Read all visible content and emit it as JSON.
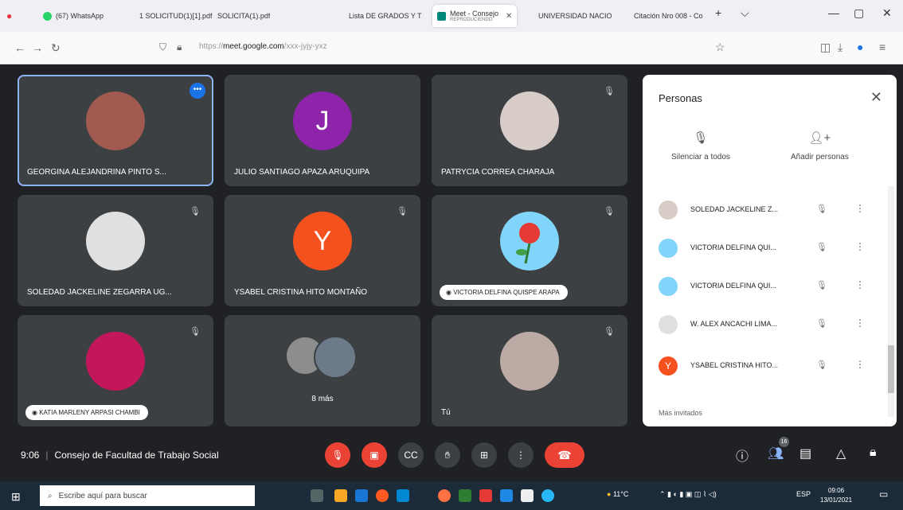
{
  "browser": {
    "tabs": [
      {
        "label": "(67) WhatsApp",
        "color": "#25d366"
      },
      {
        "label": "1 SOLICITUD(1)[1].pdf",
        "color": "#d93025"
      },
      {
        "label": "SOLICITA(1).pdf",
        "color": "#d93025"
      },
      {
        "label": "Lista DE GRADOS Y T",
        "color": "#2b579a"
      },
      {
        "label": "Meet - Consejo",
        "sublabel": "REPRODUCIENDO",
        "color": "#00897b",
        "active": true
      },
      {
        "label": "UNIVERSIDAD NACIO",
        "color": "#1a73e8"
      },
      {
        "label": "Citación Nro 008 - Co",
        "color": "#1a73e8"
      }
    ],
    "url_prefix": "https://",
    "url_domain": "meet.google.com",
    "url_path": "/xxx-jyjy-yxz"
  },
  "meeting": {
    "time": "9:06",
    "title": "Consejo de Facultad de Trabajo Social",
    "tiles": [
      {
        "name": "GEORGINA ALEJANDRINA PINTO S...",
        "avatar_color": "#a05a50"
      },
      {
        "name": "JULIO SANTIAGO APAZA ARUQUIPA",
        "initial": "J",
        "avatar_color": "#8e24aa"
      },
      {
        "name": "PATRYCIA CORREA CHARAJA",
        "avatar_color": "#d7ccc8"
      },
      {
        "name": "SOLEDAD JACKELINE ZEGARRA UG...",
        "avatar_color": "#e0e0e0"
      },
      {
        "name": "YSABEL CRISTINA HITO MONTAÑO",
        "initial": "Y",
        "avatar_color": "#f4511e"
      },
      {
        "name": "VICTORIA DELFINA QUISPE ARAPA",
        "avatar_color": "#81d4fa"
      },
      {
        "name": "KATIA MARLENY ARPASI CHAMBI",
        "avatar_color": "#c2185b"
      },
      {
        "more_label": "8 más"
      },
      {
        "name": "Tú",
        "avatar_color": "#bcaaa4"
      }
    ]
  },
  "panel": {
    "title": "Personas",
    "mute_all": "Silenciar a todos",
    "add_people": "Añadir personas",
    "people": [
      {
        "name": "SOLEDAD JACKELINE Z...",
        "avatar_color": "#d7ccc8"
      },
      {
        "name": "VICTORIA DELFINA QUI...",
        "avatar_color": "#81d4fa"
      },
      {
        "name": "VICTORIA DELFINA QUI...",
        "avatar_color": "#81d4fa"
      },
      {
        "name": "W. ALEX ANCACHI LIMA...",
        "avatar_color": "#e0e0e0"
      },
      {
        "name": "YSABEL CRISTINA HITO...",
        "initial": "Y",
        "avatar_color": "#f4511e"
      }
    ],
    "more_guests": "Más invitados"
  },
  "controls": {
    "participants_count": "16"
  },
  "taskbar": {
    "search_placeholder": "Escribe aquí para buscar",
    "weather": "11°C",
    "lang": "ESP",
    "time": "09:06",
    "date": "13/01/2021"
  }
}
